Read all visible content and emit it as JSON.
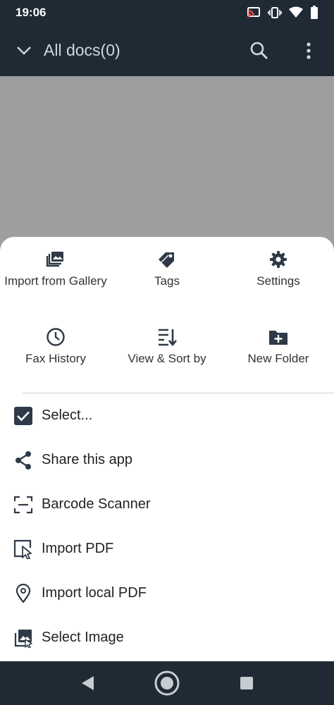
{
  "status_bar": {
    "time": "19:06",
    "icons": [
      "cast-icon",
      "vibrate-icon",
      "wifi-icon",
      "battery-icon"
    ]
  },
  "app_bar": {
    "title": "All docs(0)",
    "icons": [
      "chevron-down-icon",
      "search-icon",
      "more-vert-icon"
    ]
  },
  "sheet": {
    "grid": [
      {
        "label": "Import from Gallery",
        "icon": "gallery-icon"
      },
      {
        "label": "Tags",
        "icon": "tags-icon"
      },
      {
        "label": "Settings",
        "icon": "gear-icon"
      },
      {
        "label": "Fax History",
        "icon": "clock-icon"
      },
      {
        "label": "View & Sort by",
        "icon": "sort-icon"
      },
      {
        "label": "New Folder",
        "icon": "folder-plus-icon"
      }
    ],
    "list": [
      {
        "label": "Select...",
        "icon": "checkbox-icon"
      },
      {
        "label": "Share this app",
        "icon": "share-icon"
      },
      {
        "label": "Barcode Scanner",
        "icon": "barcode-scan-icon"
      },
      {
        "label": "Import PDF",
        "icon": "import-pdf-icon"
      },
      {
        "label": "Import local PDF",
        "icon": "location-pin-icon"
      },
      {
        "label": "Select Image",
        "icon": "image-select-icon"
      }
    ]
  },
  "colors": {
    "app_bar": "#1f2a35",
    "scrim": "#9e9e9e",
    "sheet": "#ffffff",
    "icon": "#2e3a47"
  }
}
